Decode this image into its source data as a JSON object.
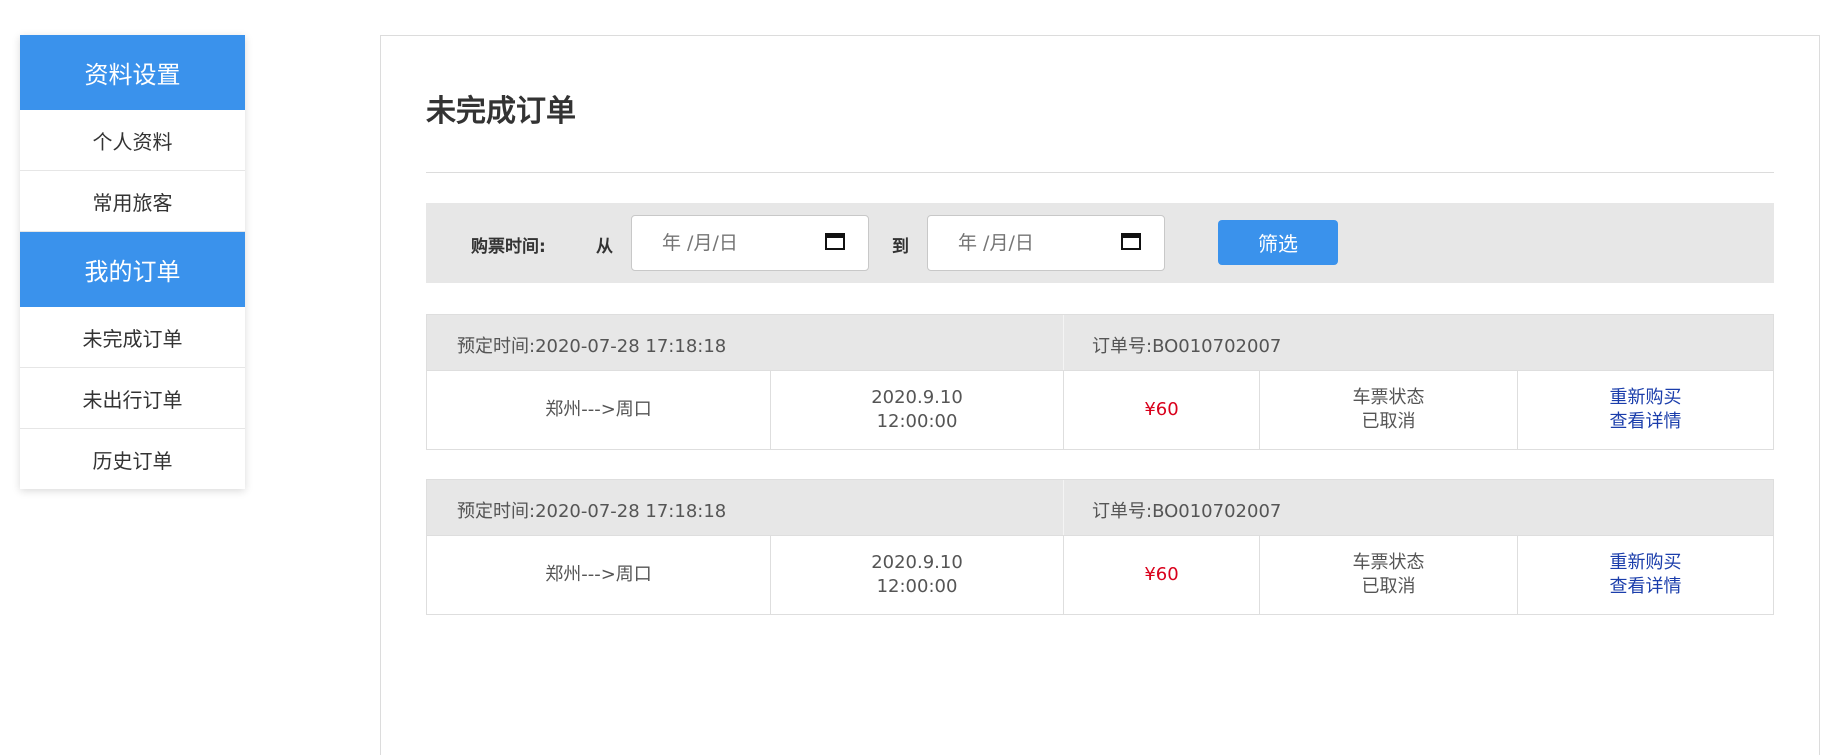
{
  "sidebar": {
    "section1_title": "资料设置",
    "section1_items": [
      "个人资料",
      "常用旅客"
    ],
    "section2_title": "我的订单",
    "section2_items": [
      "未完成订单",
      "未出行订单",
      "历史订单"
    ]
  },
  "main": {
    "title": "未完成订单",
    "filter": {
      "label": "购票时间:",
      "from": "从",
      "to": "到",
      "date_placeholder": "年 /月/日",
      "button": "筛选"
    },
    "orders": [
      {
        "booked_label": "预定时间:",
        "booked_time": "2020-07-28 17:18:18",
        "order_no_label": "订单号:",
        "order_no": "BO010702007",
        "route": "郑州--->周口",
        "date": "2020.9.10",
        "time": "12:00:00",
        "price": "¥60",
        "status_label": "车票状态",
        "status": "已取消",
        "action1": "重新购买",
        "action2": "查看详情"
      },
      {
        "booked_label": "预定时间:",
        "booked_time": "2020-07-28 17:18:18",
        "order_no_label": "订单号:",
        "order_no": "BO010702007",
        "route": "郑州--->周口",
        "date": "2020.9.10",
        "time": "12:00:00",
        "price": "¥60",
        "status_label": "车票状态",
        "status": "已取消",
        "action1": "重新购买",
        "action2": "查看详情"
      }
    ]
  },
  "colors": {
    "accent": "#3a92ec",
    "price": "#d9001b",
    "link": "#1a3dab"
  }
}
